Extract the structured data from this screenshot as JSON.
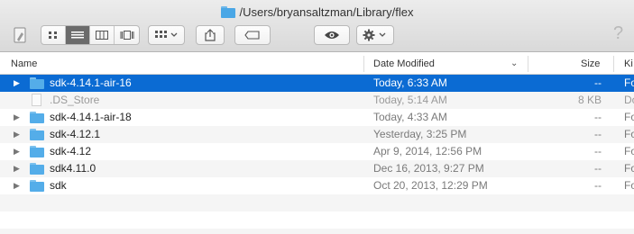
{
  "window": {
    "title": "/Users/bryansaltzman/Library/flex",
    "help_glyph": "?"
  },
  "toolbar": {
    "view_buttons": [
      "icon-view",
      "list-view",
      "column-view",
      "cover-flow-view"
    ],
    "active_view": "list-view",
    "arrange_icon": "grid-arrange-icon",
    "share_icon": "share-icon",
    "tag_icon": "tag-icon",
    "quicklook_icon": "eye-icon",
    "action_icon": "gear-icon"
  },
  "columns": {
    "name": "Name",
    "date": "Date Modified",
    "size": "Size",
    "kind": "Ki"
  },
  "files": [
    {
      "name": "sdk-4.14.1-air-16",
      "date": "Today, 6:33 AM",
      "size": "--",
      "kind": "Fo",
      "type": "folder",
      "selected": true
    },
    {
      "name": ".DS_Store",
      "date": "Today, 5:14 AM",
      "size": "8 KB",
      "kind": "Do",
      "type": "file",
      "dim": true
    },
    {
      "name": "sdk-4.14.1-air-18",
      "date": "Today, 4:33 AM",
      "size": "--",
      "kind": "Fo",
      "type": "folder"
    },
    {
      "name": "sdk-4.12.1",
      "date": "Yesterday, 3:25 PM",
      "size": "--",
      "kind": "Fo",
      "type": "folder"
    },
    {
      "name": "sdk-4.12",
      "date": "Apr 9, 2014, 12:56 PM",
      "size": "--",
      "kind": "Fo",
      "type": "folder"
    },
    {
      "name": "sdk4.11.0",
      "date": "Dec 16, 2013, 9:27 PM",
      "size": "--",
      "kind": "Fo",
      "type": "folder"
    },
    {
      "name": "sdk",
      "date": "Oct 20, 2013, 12:29 PM",
      "size": "--",
      "kind": "Fo",
      "type": "folder"
    }
  ],
  "colors": {
    "selection": "#0b6bd3",
    "folder": "#54ade9"
  }
}
